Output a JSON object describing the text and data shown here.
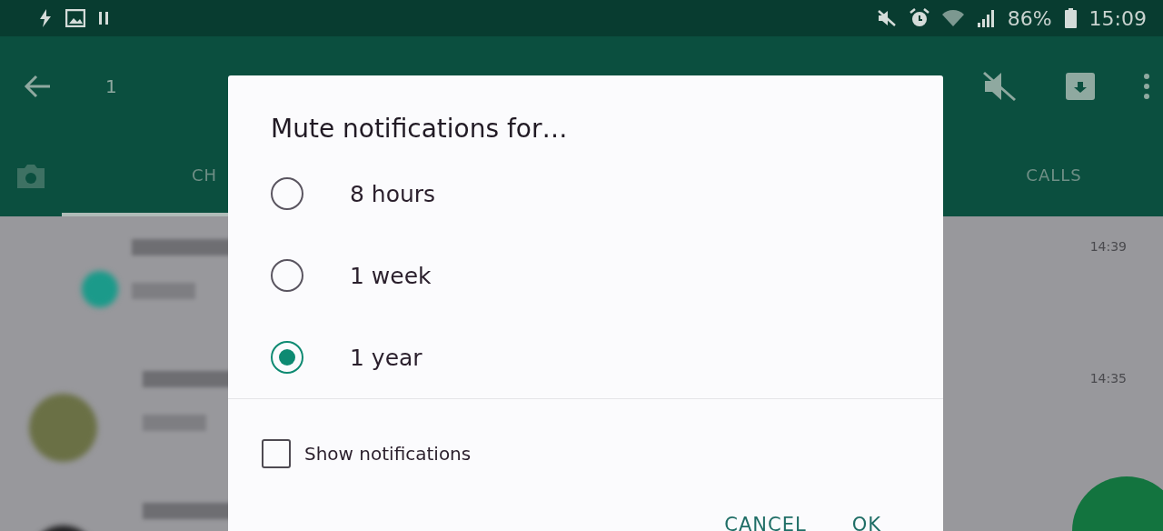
{
  "status_bar": {
    "battery": "86%",
    "time": "15:09"
  },
  "toolbar": {
    "title": "1"
  },
  "tabs": [
    {
      "label": "CH",
      "selected": true
    },
    {
      "label": "CALLS",
      "selected": false
    }
  ],
  "chat_list": [
    {
      "time": "14:39"
    },
    {
      "time": "14:35"
    }
  ],
  "dialog": {
    "title": "Mute notifications for…",
    "options": [
      {
        "label": "8 hours",
        "selected": false
      },
      {
        "label": "1 week",
        "selected": false
      },
      {
        "label": "1 year",
        "selected": true
      }
    ],
    "show_notifications": {
      "label": "Show notifications",
      "checked": false
    },
    "buttons": [
      "CANCEL",
      "OK"
    ]
  }
}
